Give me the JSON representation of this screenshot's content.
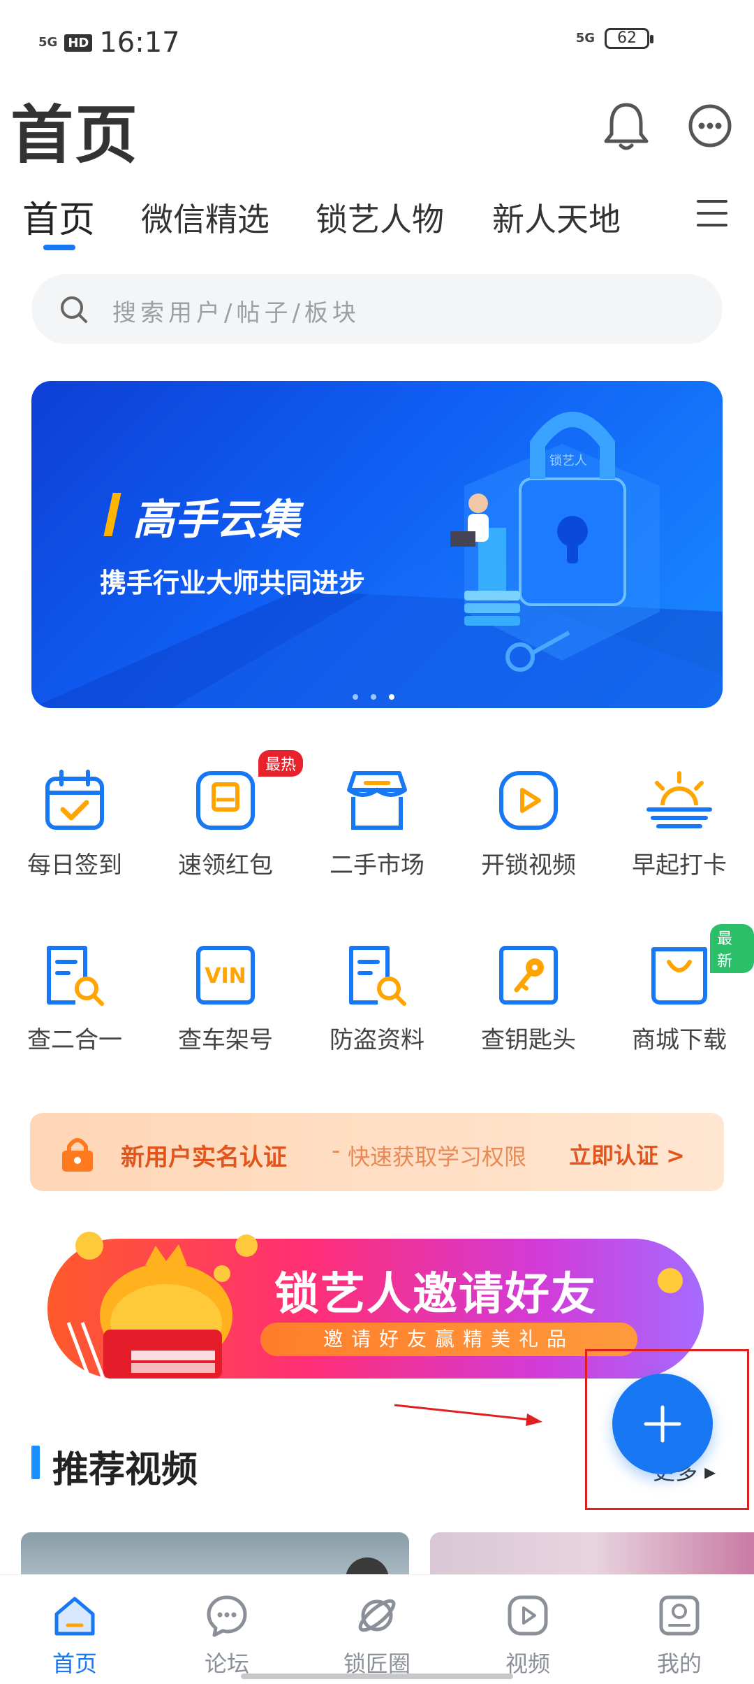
{
  "status_bar": {
    "network_left": "5G",
    "hd": "HD",
    "time": "16:17",
    "network_right": "5G",
    "battery": "62"
  },
  "header": {
    "title": "首页"
  },
  "tabs": [
    {
      "label": "首页"
    },
    {
      "label": "微信精选"
    },
    {
      "label": "锁艺人物"
    },
    {
      "label": "新人天地"
    }
  ],
  "search": {
    "placeholder": "搜索用户/帖子/板块"
  },
  "banner": {
    "title": "高手云集",
    "subtitle": "携手行业大师共同进步",
    "lock_text": "锁艺人"
  },
  "grid": [
    {
      "label": "每日签到",
      "icon": "calendar-check-icon"
    },
    {
      "label": "速领红包",
      "icon": "red-envelope-icon",
      "badge": "最热"
    },
    {
      "label": "二手市场",
      "icon": "store-icon"
    },
    {
      "label": "开锁视频",
      "icon": "play-video-icon"
    },
    {
      "label": "早起打卡",
      "icon": "sunrise-icon"
    },
    {
      "label": "查二合一",
      "icon": "doc-search-icon"
    },
    {
      "label": "查车架号",
      "icon": "vin-icon",
      "icon_text": "VIN"
    },
    {
      "label": "防盗资料",
      "icon": "doc-search-icon"
    },
    {
      "label": "查钥匙头",
      "icon": "key-icon"
    },
    {
      "label": "商城下载",
      "icon": "shopping-bag-icon",
      "badge": "最新"
    }
  ],
  "verify": {
    "title": "新用户实名认证",
    "dash": "-",
    "desc": "快速获取学习权限",
    "action": "立即认证 >"
  },
  "invite": {
    "title": "锁艺人邀请好友",
    "subtitle": "邀请好友赢精美礼品"
  },
  "section": {
    "title": "推荐视频",
    "more": "更多 ▸"
  },
  "bottom_nav": [
    {
      "label": "首页",
      "icon": "home-icon",
      "active": true
    },
    {
      "label": "论坛",
      "icon": "chat-bubble-icon"
    },
    {
      "label": "锁匠圈",
      "icon": "planet-icon"
    },
    {
      "label": "视频",
      "icon": "video-icon"
    },
    {
      "label": "我的",
      "icon": "profile-icon"
    }
  ],
  "colors": {
    "primary": "#1877f2",
    "icon_orange": "#ffa400",
    "badge_red": "#e8222d",
    "badge_green": "#2cbf6a",
    "verify_text": "#e2541c"
  }
}
